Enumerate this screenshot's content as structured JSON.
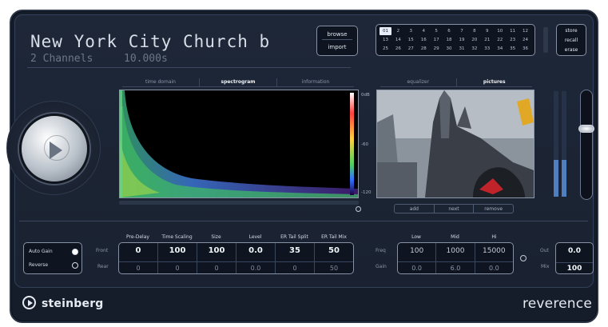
{
  "preset": {
    "title": "New York City Church b",
    "channels": "2 Channels",
    "length": "10.000s"
  },
  "file_buttons": {
    "browse": "browse",
    "import": "import"
  },
  "slots": [
    "01",
    "2",
    "3",
    "4",
    "5",
    "6",
    "7",
    "8",
    "9",
    "10",
    "11",
    "12",
    "13",
    "14",
    "15",
    "16",
    "17",
    "18",
    "19",
    "20",
    "21",
    "22",
    "23",
    "24",
    "25",
    "26",
    "27",
    "28",
    "29",
    "30",
    "31",
    "32",
    "33",
    "34",
    "35",
    "36"
  ],
  "preset_buttons": {
    "store": "store",
    "recall": "recall",
    "erase": "erase"
  },
  "display_tabs": [
    "time domain",
    "spectrogram",
    "information"
  ],
  "picture_tabs": [
    "equalizer",
    "pictures"
  ],
  "colorbar_labels": {
    "top": "0dB",
    "mid": "-60",
    "bottom": "-120"
  },
  "picture_buttons": [
    "add",
    "next",
    "remove"
  ],
  "toggles": {
    "auto_gain": "Auto Gain",
    "reverse": "Reverse",
    "auto_gain_on": true,
    "reverse_on": false
  },
  "row_labels": {
    "front": "Front",
    "rear": "Rear",
    "freq": "Freq",
    "gain": "Gain",
    "out": "Out",
    "mix": "Mix"
  },
  "params": [
    {
      "name": "Pre-Delay",
      "front": "0",
      "rear": "0"
    },
    {
      "name": "Time Scaling",
      "front": "100",
      "rear": "0"
    },
    {
      "name": "Size",
      "front": "100",
      "rear": "0"
    },
    {
      "name": "Level",
      "front": "0.0",
      "rear": "0.0"
    },
    {
      "name": "ER Tail Split",
      "front": "35",
      "rear": "0"
    },
    {
      "name": "ER Tail Mix",
      "front": "50",
      "rear": "50"
    }
  ],
  "eq": [
    {
      "name": "Low",
      "freq": "100",
      "gain": "0.0"
    },
    {
      "name": "Mid",
      "freq": "1000",
      "gain": "6.0"
    },
    {
      "name": "Hi",
      "freq": "15000",
      "gain": "0.0"
    }
  ],
  "output": {
    "out": "0.0",
    "mix": "100"
  },
  "meters": {
    "left_level": 0.35,
    "right_level": 0.35
  },
  "fader_level": 0.66,
  "brand": "steinberg",
  "product": "reverence",
  "colors": {
    "background": "#1a2231",
    "accent": "#e8eef7",
    "meter": "#4f7fbf"
  }
}
